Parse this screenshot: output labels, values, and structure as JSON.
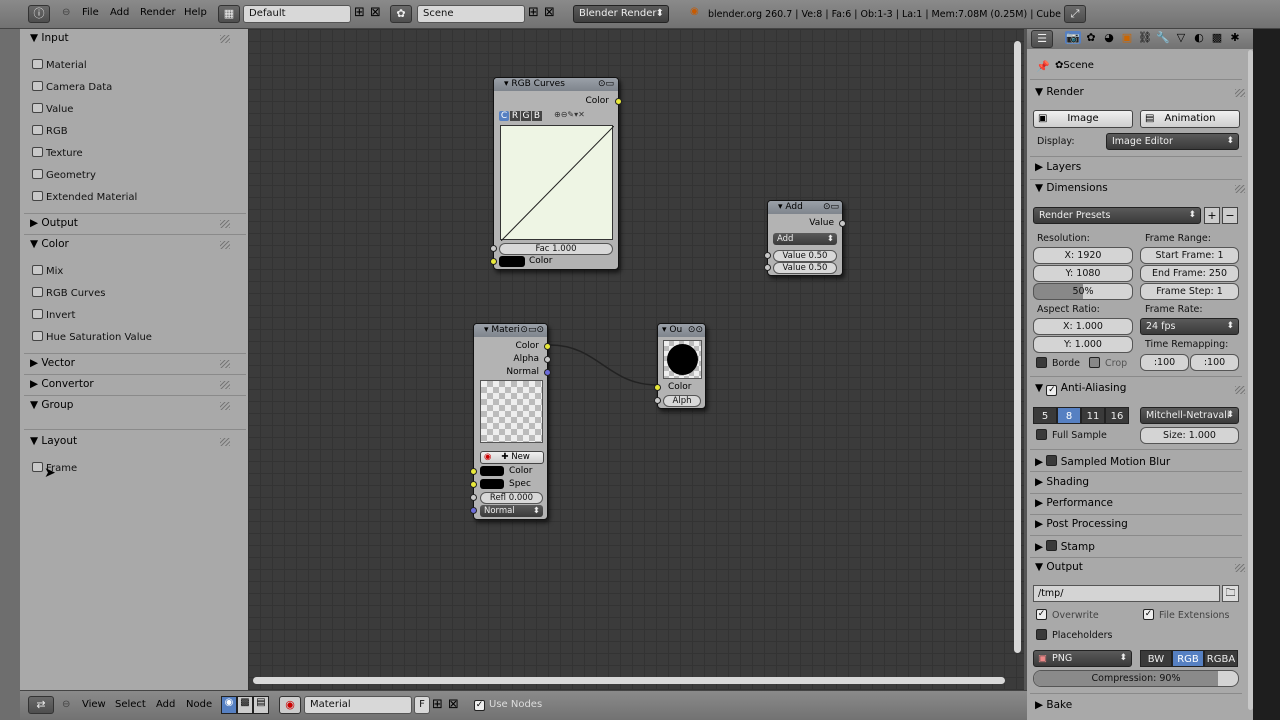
{
  "topbar": {
    "menus": [
      "File",
      "Add",
      "Render",
      "Help"
    ],
    "layout": "Default",
    "scene": "Scene",
    "engine": "Blender Render",
    "stats": "blender.org 260.7 | Ve:8 | Fa:6 | Ob:1-3 | La:1 | Mem:7.08M (0.25M) | Cube"
  },
  "left": {
    "input_header": "Input",
    "input_items": [
      "Material",
      "Camera Data",
      "Value",
      "RGB",
      "Texture",
      "Geometry",
      "Extended Material"
    ],
    "output_header": "Output",
    "color_header": "Color",
    "color_items": [
      "Mix",
      "RGB Curves",
      "Invert",
      "Hue Saturation Value"
    ],
    "vector_header": "Vector",
    "convertor_header": "Convertor",
    "group_header": "Group",
    "layout_header": "Layout",
    "layout_items": [
      "Frame"
    ]
  },
  "nodes": {
    "rgbcurves": {
      "title": "RGB Curves",
      "out": "Color",
      "channels": [
        "C",
        "R",
        "G",
        "B"
      ],
      "fac": "Fac 1.000",
      "color_label": "Color"
    },
    "add": {
      "title": "Add",
      "out": "Value",
      "op": "Add",
      "v1": "Value 0.50",
      "v2": "Value 0.50"
    },
    "material": {
      "title": "Materi",
      "outs": [
        "Color",
        "Alpha",
        "Normal"
      ],
      "new": "New",
      "color": "Color",
      "spec": "Spec",
      "refl": "Refl 0.000",
      "normal": "Normal"
    },
    "output": {
      "title": "Ou",
      "color": "Color",
      "alpha": "Alph"
    }
  },
  "right": {
    "scene": "Scene",
    "render_header": "Render",
    "image_btn": "Image",
    "anim_btn": "Animation",
    "display_label": "Display:",
    "display_value": "Image Editor",
    "layers_header": "Layers",
    "dimensions_header": "Dimensions",
    "render_presets": "Render Presets",
    "resolution_label": "Resolution:",
    "frame_range_label": "Frame Range:",
    "res_x": "X: 1920",
    "res_y": "Y: 1080",
    "res_pct": "50%",
    "start_frame": "Start Frame: 1",
    "end_frame": "End Frame: 250",
    "frame_step": "Frame Step: 1",
    "aspect_label": "Aspect Ratio:",
    "frame_rate_label": "Frame Rate:",
    "asp_x": "X: 1.000",
    "asp_y": "Y: 1.000",
    "fps": "24 fps",
    "time_remap_label": "Time Remapping:",
    "remap_old": ":100",
    "remap_new": ":100",
    "borde": "Borde",
    "crop": "Crop",
    "aa_header": "Anti-Aliasing",
    "aa_levels": [
      "5",
      "8",
      "11",
      "16"
    ],
    "aa_filter": "Mitchell-Netravali",
    "full_sample": "Full Sample",
    "aa_size": "Size: 1.000",
    "smb_header": "Sampled Motion Blur",
    "shading_header": "Shading",
    "performance_header": "Performance",
    "postproc_header": "Post Processing",
    "stamp_header": "Stamp",
    "output_header": "Output",
    "output_path": "/tmp/",
    "overwrite": "Overwrite",
    "file_ext": "File Extensions",
    "placeholders": "Placeholders",
    "format": "PNG",
    "color_modes": [
      "BW",
      "RGB",
      "RGBA"
    ],
    "compression": "Compression: 90%",
    "compression_value": 0.9,
    "bake_header": "Bake"
  },
  "bottom": {
    "menus": [
      "View",
      "Select",
      "Add",
      "Node"
    ],
    "material": "Material",
    "f": "F",
    "use_nodes": "Use Nodes"
  }
}
